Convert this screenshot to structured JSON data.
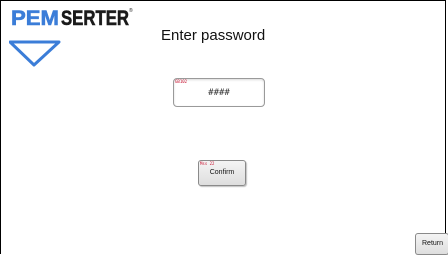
{
  "brand": {
    "logo_text_primary": "PEM",
    "logo_text_secondary": "SERTER",
    "logo_mark": "®",
    "color_blue": "#3b7dd8",
    "color_dark": "#1a1a1a"
  },
  "header": {
    "title": "Enter password"
  },
  "password_field": {
    "tag": "GB102",
    "value": "####"
  },
  "confirm_button": {
    "tag": "Mss 22",
    "label": "Confirm"
  },
  "return_button": {
    "label": "Return"
  }
}
